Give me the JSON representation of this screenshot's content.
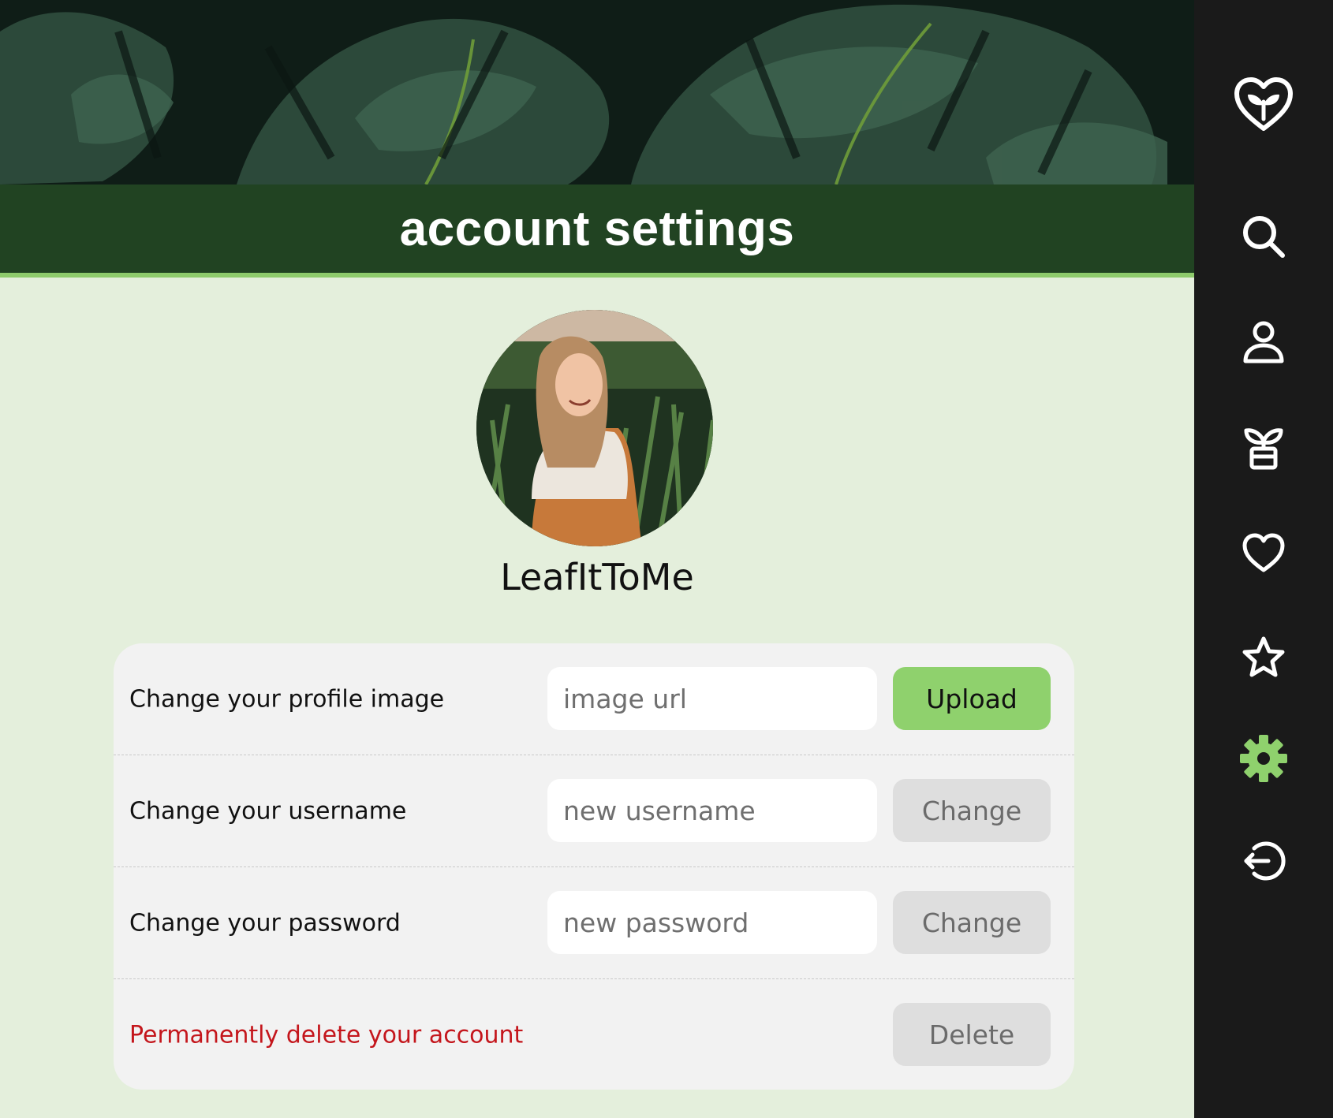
{
  "page": {
    "title": "account settings"
  },
  "profile": {
    "username": "LeafItToMe"
  },
  "settings": {
    "rows": [
      {
        "label": "Change your profile image",
        "placeholder": "image url",
        "button": "Upload"
      },
      {
        "label": "Change your username",
        "placeholder": "new username",
        "button": "Change"
      },
      {
        "label": "Change your password",
        "placeholder": "new password",
        "button": "Change"
      },
      {
        "label": "Permanently delete your account",
        "button": "Delete"
      }
    ]
  },
  "sidebar": {
    "items": [
      {
        "icon": "leaf-heart-logo-icon"
      },
      {
        "icon": "search-icon"
      },
      {
        "icon": "user-icon"
      },
      {
        "icon": "plant-pot-icon"
      },
      {
        "icon": "heart-icon"
      },
      {
        "icon": "star-icon"
      },
      {
        "icon": "gear-icon",
        "active": true
      },
      {
        "icon": "logout-icon"
      }
    ]
  },
  "colors": {
    "title_bar": "#214322",
    "accent_green": "#8fd16d",
    "sidebar_bg": "#1a1a1a",
    "page_bg": "#e4efdc",
    "danger": "#c4161c"
  }
}
